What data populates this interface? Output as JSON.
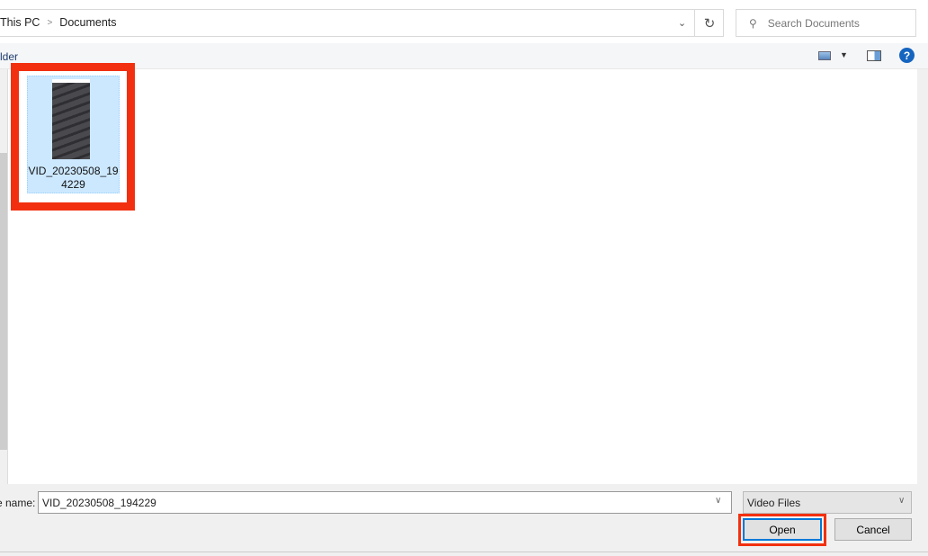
{
  "address": {
    "crumbs": [
      "This PC",
      "Documents"
    ],
    "separator": ">"
  },
  "search": {
    "placeholder": "Search Documents"
  },
  "toolbar": {
    "new_folder_label": "lder"
  },
  "files": [
    {
      "name": "VID_20230508_194229",
      "display_name": "VID_20230508_19 4229",
      "selected": true
    }
  ],
  "footer": {
    "file_name_label": "e name:",
    "file_name_value": "VID_20230508_194229",
    "file_type": "Video Files",
    "open_label": "Open",
    "cancel_label": "Cancel"
  },
  "colors": {
    "highlight": "#f2300f",
    "selection": "#cce8ff",
    "accent": "#0078d7"
  }
}
